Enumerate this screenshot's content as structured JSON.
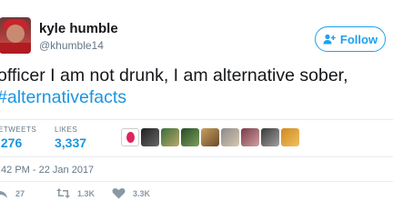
{
  "user": {
    "display_name": "kyle humble",
    "handle": "@khumble14",
    "avatar_icon": "profile-photo"
  },
  "follow_button": {
    "label": "Follow",
    "icon": "person-plus-icon"
  },
  "tweet": {
    "text": "officer I am not drunk, I am alternative sober,",
    "hashtag": "#alternativefacts"
  },
  "stats": {
    "retweets_label": "ETWEETS",
    "retweets_value": ",276",
    "likes_label": "LIKES",
    "likes_value": "3,337"
  },
  "likers_count_shown": 9,
  "timestamp": ":42 PM - 22 Jan 2017",
  "actions": {
    "reply_count": "27",
    "retweet_count": "1.3K",
    "like_count": "3.3K"
  },
  "colors": {
    "accent": "#1da1f2",
    "link": "#1b95e0",
    "muted": "#657786",
    "icon_muted": "#8899a6",
    "divider": "#e6ecf0"
  }
}
